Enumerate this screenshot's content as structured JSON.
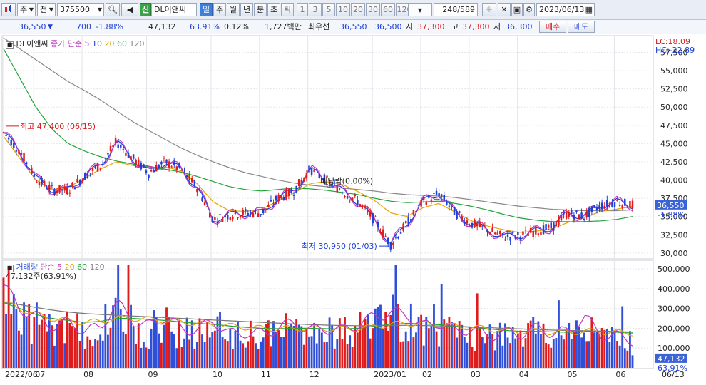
{
  "toolbar": {
    "market_select": "주",
    "period_select": "전",
    "code": "375500",
    "stock_name": "DL이앤씨",
    "new_badge": "신",
    "periods": [
      "일",
      "주",
      "월",
      "년",
      "분",
      "초",
      "틱"
    ],
    "active_period": "일",
    "minutes": [
      "1",
      "3",
      "5",
      "10",
      "20",
      "30",
      "60",
      "120"
    ],
    "count": "248",
    "total": "/589",
    "date": "2023/06/13"
  },
  "quote": {
    "price": "36,550",
    "arrow": "▼",
    "change": "700",
    "change_pct": "-1.88%",
    "volume": "47,132",
    "vol_ratio": "63.91%",
    "turnover": "0.12%",
    "amount": "1,727백만",
    "priority_label": "최우선",
    "ask": "36,550",
    "bid": "36,500",
    "open_label": "시",
    "open": "37,300",
    "high_label": "고",
    "high": "37,300",
    "low_label": "저",
    "low": "36,300",
    "buy_label": "매수",
    "sell_label": "매도"
  },
  "colors": {
    "up": "#e01b1b",
    "down": "#1f3fd6",
    "ma5": "#c13ac1",
    "ma10": "#1f3fd6",
    "ma20": "#e6a400",
    "ma60": "#21a33a",
    "ma120": "#888888",
    "volume_up": "#e01b1b",
    "volume_down": "#2f4fd8"
  },
  "chart_data": [
    {
      "type": "candlestick",
      "title": "DL이앤씨",
      "legend": {
        "label": "종가 단순",
        "periods": [
          "5",
          "10",
          "20",
          "60",
          "120"
        ]
      },
      "y_ticks": [
        30000,
        32500,
        35000,
        37500,
        40000,
        42500,
        45000,
        47500,
        50000,
        52500,
        55000,
        57500
      ],
      "y_tick_labels": [
        "30,000",
        "32,500",
        "35,000",
        "37,500",
        "40,000",
        "42,500",
        "45,000",
        "47,500",
        "50,000",
        "52,500",
        "55,000",
        "57,500"
      ],
      "ylim": [
        29300,
        59800
      ],
      "top_right": {
        "lc": "LC:18.09",
        "hc": "HC:-22.89"
      },
      "current_price": {
        "value": 36550,
        "label": "36,550",
        "pct": "-1.88%"
      },
      "annotations": [
        {
          "text": "최고 47,400 (06/15)",
          "value": 47400,
          "month": "2022/06"
        },
        {
          "text": "최저 30,950 (01/03)",
          "value": 30950,
          "month": "2023/01"
        },
        {
          "text": "배당락(0.00%)",
          "value": 39900,
          "month": "2022/12"
        }
      ],
      "close_path": [
        {
          "m": "2022/06",
          "close": 46500
        },
        {
          "m": "2022/06",
          "close": 44000
        },
        {
          "m": "2022/07",
          "close": 40200
        },
        {
          "m": "2022/07",
          "close": 38700
        },
        {
          "m": "2022/07",
          "close": 38600
        },
        {
          "m": "2022/08",
          "close": 40500
        },
        {
          "m": "2022/08",
          "close": 42000
        },
        {
          "m": "2022/08",
          "close": 45200
        },
        {
          "m": "2022/08",
          "close": 43000
        },
        {
          "m": "2022/09",
          "close": 41000
        },
        {
          "m": "2022/09",
          "close": 42500
        },
        {
          "m": "2022/09",
          "close": 41500
        },
        {
          "m": "2022/09",
          "close": 39000
        },
        {
          "m": "2022/10",
          "close": 34600
        },
        {
          "m": "2022/10",
          "close": 35200
        },
        {
          "m": "2022/10",
          "close": 35500
        },
        {
          "m": "2022/11",
          "close": 35500
        },
        {
          "m": "2022/11",
          "close": 37500
        },
        {
          "m": "2022/11",
          "close": 38500
        },
        {
          "m": "2022/12",
          "close": 41500
        },
        {
          "m": "2022/12",
          "close": 40000
        },
        {
          "m": "2022/12",
          "close": 38500
        },
        {
          "m": "2022/12",
          "close": 37000
        },
        {
          "m": "2023/01",
          "close": 34500
        },
        {
          "m": "2023/01",
          "close": 31200
        },
        {
          "m": "2023/01",
          "close": 34000
        },
        {
          "m": "2023/02",
          "close": 37000
        },
        {
          "m": "2023/02",
          "close": 38200
        },
        {
          "m": "2023/02",
          "close": 35500
        },
        {
          "m": "2023/03",
          "close": 34000
        },
        {
          "m": "2023/03",
          "close": 33200
        },
        {
          "m": "2023/03",
          "close": 32200
        },
        {
          "m": "2023/04",
          "close": 32400
        },
        {
          "m": "2023/04",
          "close": 33000
        },
        {
          "m": "2023/04",
          "close": 33500
        },
        {
          "m": "2023/05",
          "close": 35500
        },
        {
          "m": "2023/05",
          "close": 35000
        },
        {
          "m": "2023/05",
          "close": 36500
        },
        {
          "m": "2023/06",
          "close": 37000
        },
        {
          "m": "2023/06",
          "close": 36550
        }
      ],
      "ma20_path": [
        46000,
        43000,
        40000,
        38700,
        39000,
        40200,
        41500,
        42500,
        42000,
        41700,
        41800,
        41300,
        39500,
        37000,
        35800,
        35700,
        36000,
        37100,
        38200,
        39500,
        39800,
        39400,
        38400,
        37200,
        35500,
        35000,
        36200,
        36800,
        35600,
        34400,
        33700,
        33200,
        32800,
        33000,
        33300,
        34200,
        34800,
        35700,
        36000,
        36400
      ],
      "ma60_path": [
        58000,
        54000,
        50000,
        47000,
        45000,
        44000,
        43200,
        42600,
        42200,
        41800,
        41500,
        41100,
        40500,
        39800,
        39100,
        38700,
        38500,
        38700,
        38900,
        38800,
        38600,
        38300,
        38000,
        37500,
        37100,
        36900,
        37000,
        37100,
        36800,
        36400,
        35900,
        35300,
        34800,
        34500,
        34300,
        34300,
        34300,
        34400,
        34600,
        35000
      ],
      "ma120_path": [
        59500,
        58000,
        56500,
        55000,
        53500,
        52300,
        51000,
        49500,
        48000,
        46800,
        45600,
        44400,
        43400,
        42500,
        41700,
        41000,
        40500,
        40000,
        39600,
        39300,
        39100,
        38900,
        38700,
        38500,
        38200,
        38000,
        37900,
        37800,
        37600,
        37300,
        37000,
        36700,
        36400,
        36200,
        36000,
        35900,
        35800,
        35800,
        35800,
        35900
      ]
    },
    {
      "type": "bar",
      "title": "거래량",
      "legend": {
        "label": "단순",
        "periods": [
          "5",
          "20",
          "60",
          "120"
        ]
      },
      "current_volume_label": "47,132주(63,91%)",
      "y_ticks": [
        100000,
        200000,
        300000,
        400000,
        500000
      ],
      "y_tick_labels": [
        "100,000",
        "200,000",
        "300,000",
        "400,000",
        "500,000"
      ],
      "ylim": [
        0,
        540000
      ],
      "current": {
        "label": "47,132",
        "pct": "63,91%"
      },
      "volume_path": [
        420000,
        300000,
        260000,
        210000,
        230000,
        190000,
        200000,
        330000,
        240000,
        210000,
        260000,
        200000,
        190000,
        240000,
        170000,
        180000,
        170000,
        200000,
        230000,
        190000,
        200000,
        190000,
        220000,
        260000,
        280000,
        270000,
        210000,
        230000,
        180000,
        200000,
        160000,
        180000,
        170000,
        200000,
        180000,
        180000,
        260000,
        170000,
        160000,
        140000
      ],
      "ma20_path": [
        330000,
        300000,
        270000,
        250000,
        240000,
        230000,
        235000,
        250000,
        250000,
        245000,
        240000,
        232000,
        225000,
        220000,
        212000,
        205000,
        200000,
        198000,
        200000,
        200000,
        198000,
        196000,
        200000,
        210000,
        220000,
        225000,
        222000,
        218000,
        210000,
        205000,
        198000,
        190000,
        185000,
        185000,
        182000,
        180000,
        185000,
        183000,
        180000,
        176000
      ],
      "ma60_path": [
        330000,
        320000,
        305000,
        292000,
        282000,
        275000,
        270000,
        266000,
        262000,
        258000,
        254000,
        250000,
        246000,
        242000,
        238000,
        234000,
        230000,
        226000,
        222000,
        219000,
        216000,
        214000,
        213000,
        213000,
        214000,
        215000,
        214000,
        212000,
        210000,
        207000,
        204000,
        200000,
        197000,
        194000,
        191000,
        189000,
        188000,
        186000,
        184000,
        181000
      ]
    }
  ],
  "x_axis": {
    "labels": [
      "2022/06",
      "07",
      "08",
      "09",
      "10",
      "11",
      "12",
      "2023/01",
      "02",
      "03",
      "04",
      "05",
      "06",
      "06/13"
    ]
  }
}
